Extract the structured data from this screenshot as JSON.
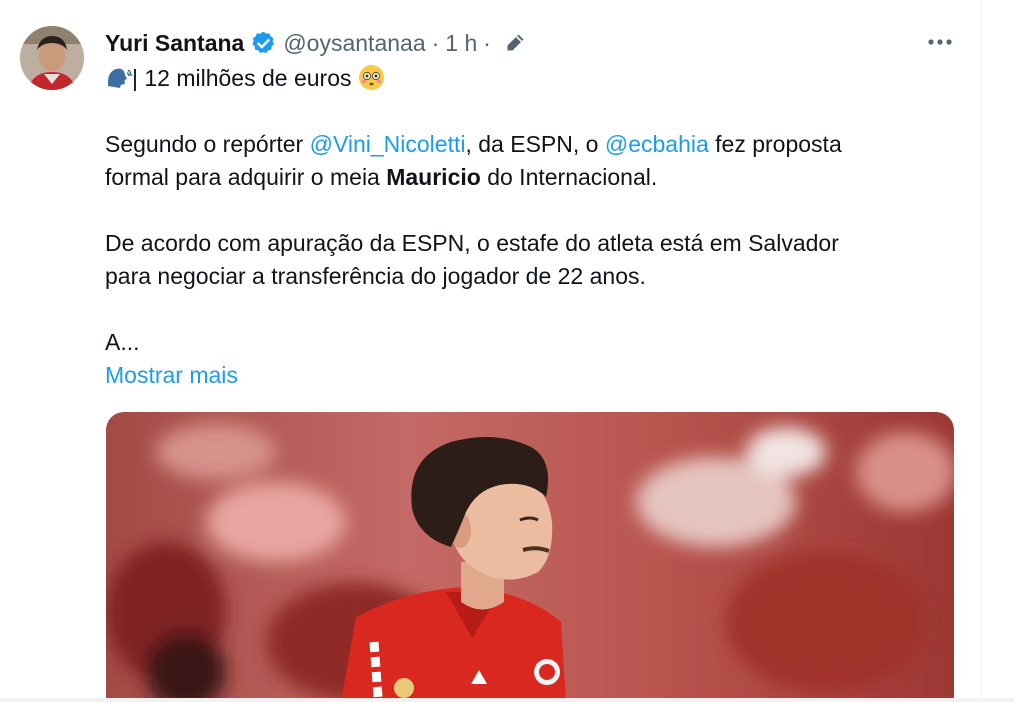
{
  "tweet": {
    "author_name": "Yuri Santana",
    "handle": "@oysantanaa",
    "separator": "·",
    "time": "1 h",
    "headline": {
      "emoji_icon": "speaking-head-icon",
      "text": "| 12 milhões de euros",
      "trailing_emoji_icon": "flushed-face-icon"
    },
    "paragraph1": {
      "part1": "Segundo o repórter ",
      "mention1": "@Vini_Nicoletti",
      "part2": ", da ESPN, o ",
      "mention2": "@ecbahia",
      "part3": " fez proposta",
      "line2_part1": "formal para adquirir o meia ",
      "bold_name": "Mauricio",
      "line2_part2": " do Internacional."
    },
    "paragraph2": {
      "line1": "De acordo com apuração da ESPN, o estafe do atleta está em Salvador",
      "line2": "para negociar a transferência do jogador de 22 anos."
    },
    "truncated_text": "A...",
    "show_more_label": "Mostrar mais"
  },
  "colors": {
    "link": "#1d9bf0",
    "text": "#0f1419",
    "muted": "#536471",
    "jersey_red": "#d8281f"
  }
}
